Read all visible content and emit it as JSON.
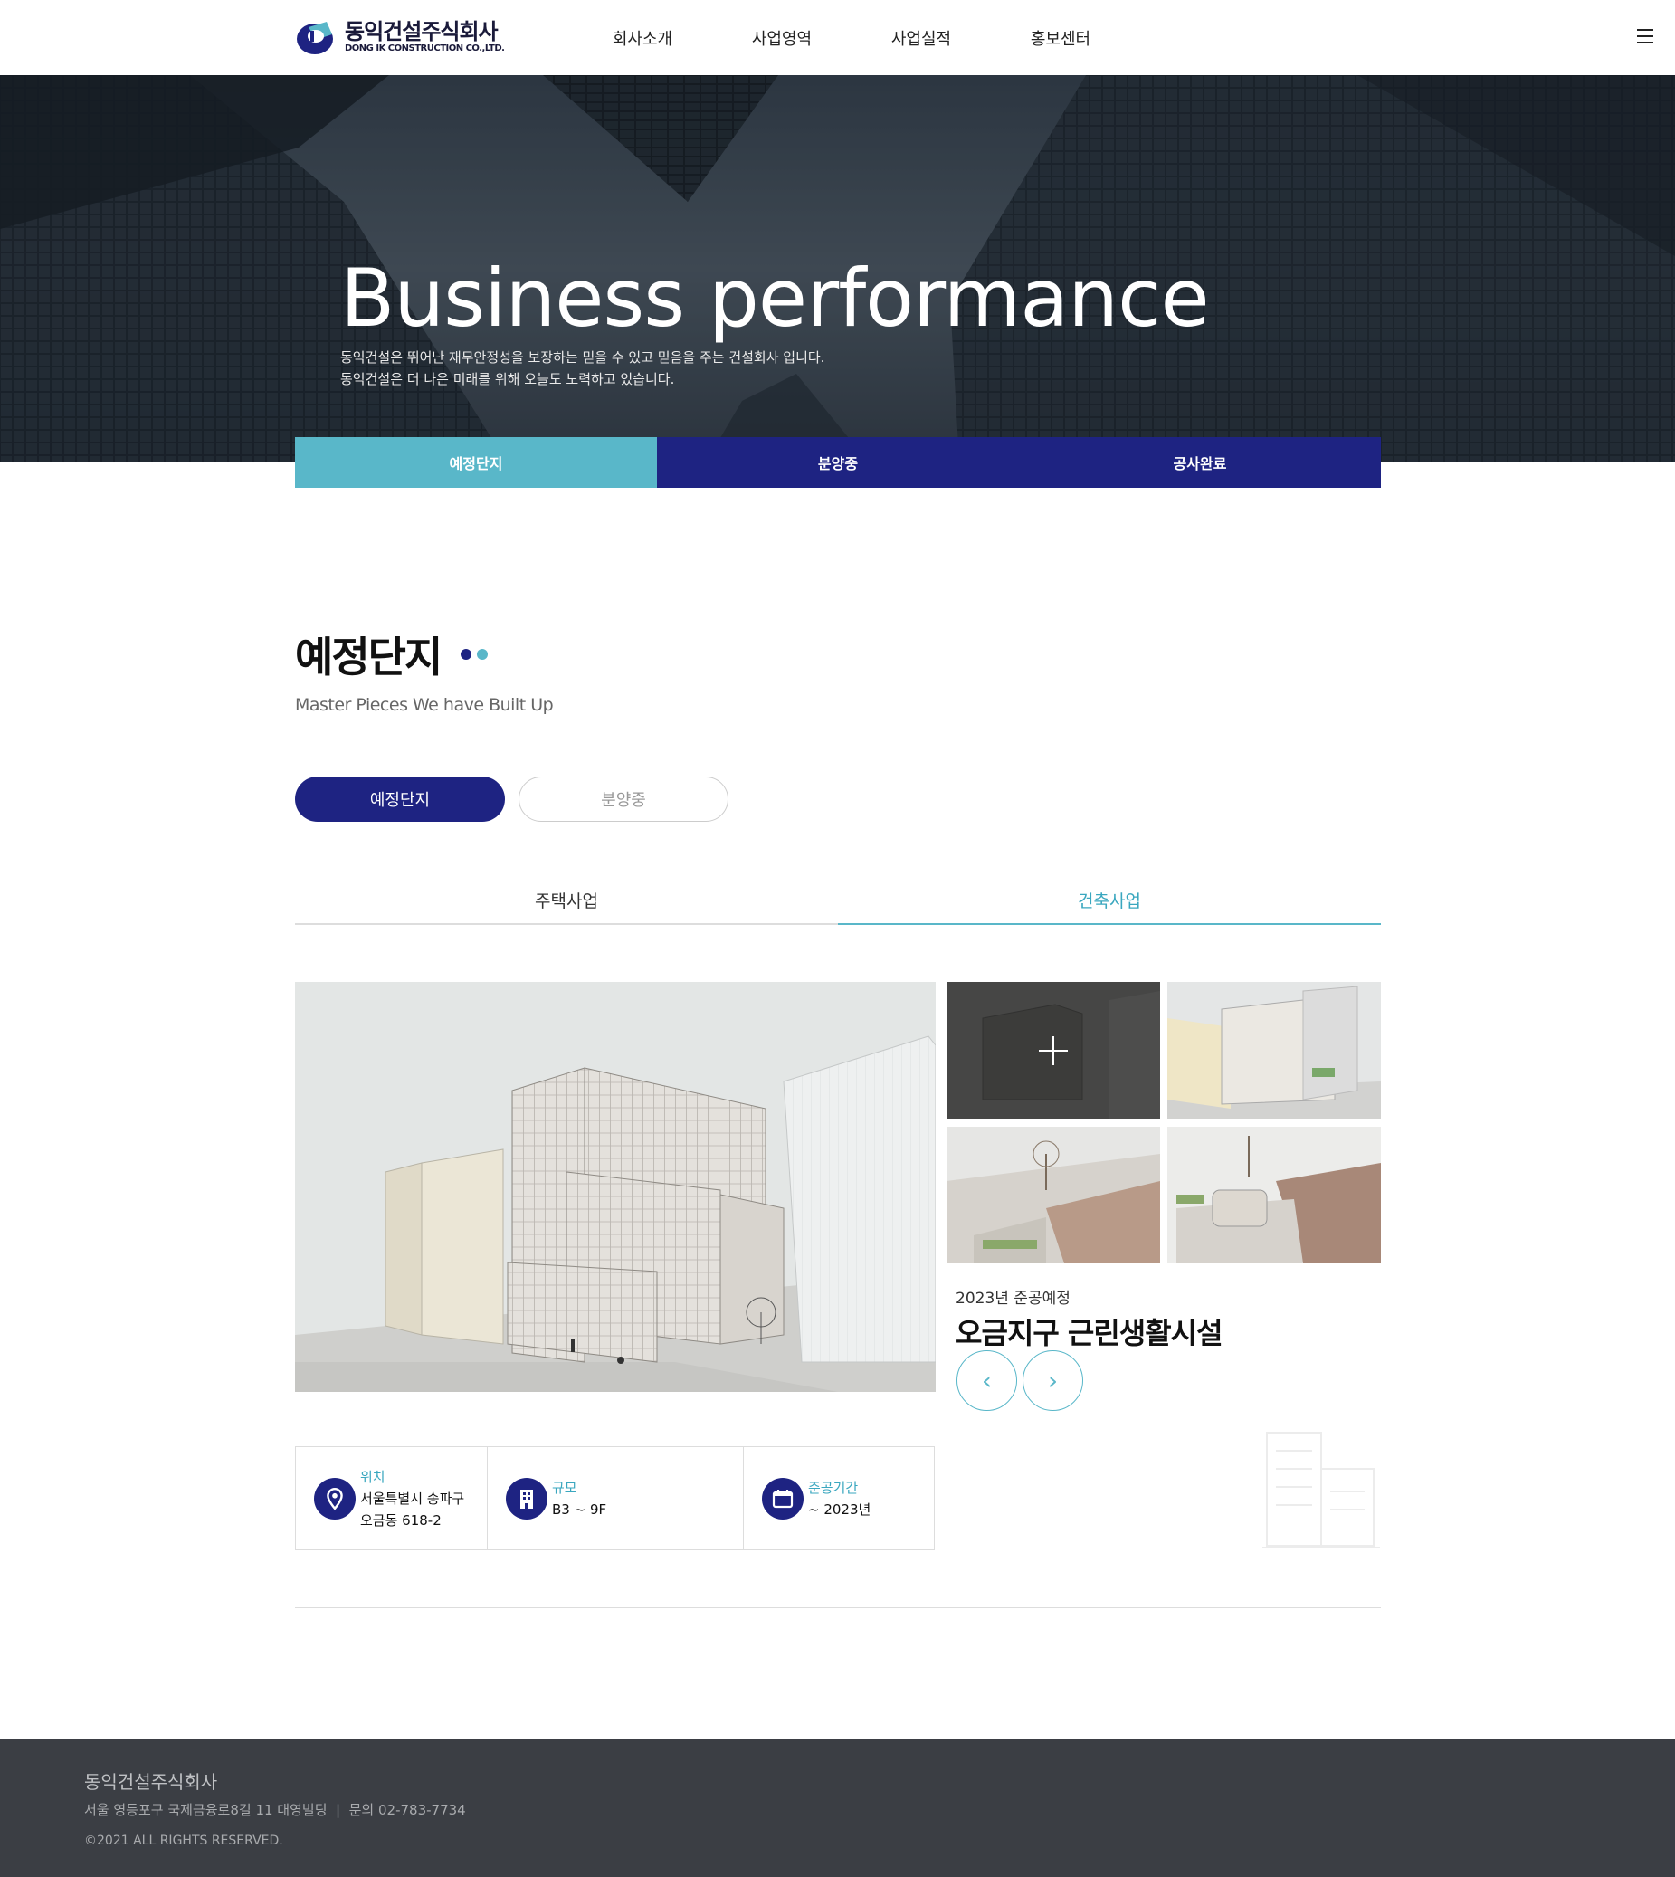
{
  "header": {
    "logo_kr": "동익건설주식회사",
    "logo_en": "DONG IK CONSTRUCTION CO.,LTD.",
    "nav": [
      "회사소개",
      "사업영역",
      "사업실적",
      "홍보센터"
    ]
  },
  "hero": {
    "title": "Business performance",
    "desc_line1": "동익건설은 뛰어난 재무안정성을 보장하는 믿을 수 있고 믿음을 주는 건설회사 입니다.",
    "desc_line2": "동익건설은 더 나은 미래를 위해 오늘도 노력하고 있습니다."
  },
  "top_tabs": [
    "예정단지",
    "분양중",
    "공사완료"
  ],
  "section": {
    "title": "예정단지",
    "subtitle": "Master Pieces We have Built Up",
    "dot_colors": [
      "#1e2382",
      "#59b7c9"
    ]
  },
  "pills": {
    "active": "예정단지",
    "inactive": "분양중"
  },
  "sub_tabs": {
    "left": "주택사업",
    "right": "건축사업"
  },
  "project": {
    "year": "2023년 준공예정",
    "name": "오금지구 근린생활시설",
    "prev": "‹",
    "next": "›"
  },
  "specs": {
    "location_label": "위치",
    "location_line1": "서울특별시 송파구",
    "location_line2": "오금동 618-2",
    "scale_label": "규모",
    "scale_value": "B3 ~ 9F",
    "period_label": "준공기간",
    "period_value": "~ 2023년"
  },
  "footer": {
    "company": "동익건설주식회사",
    "address": "서울 영등포구 국제금융로8길 11 대영빌딩  |  문의 02-783-7734",
    "copyright": "©2021 ALL RIGHTS RESERVED."
  },
  "colors": {
    "navy": "#1e2382",
    "teal": "#59b7c9",
    "footer_bg": "#3b3e44"
  }
}
